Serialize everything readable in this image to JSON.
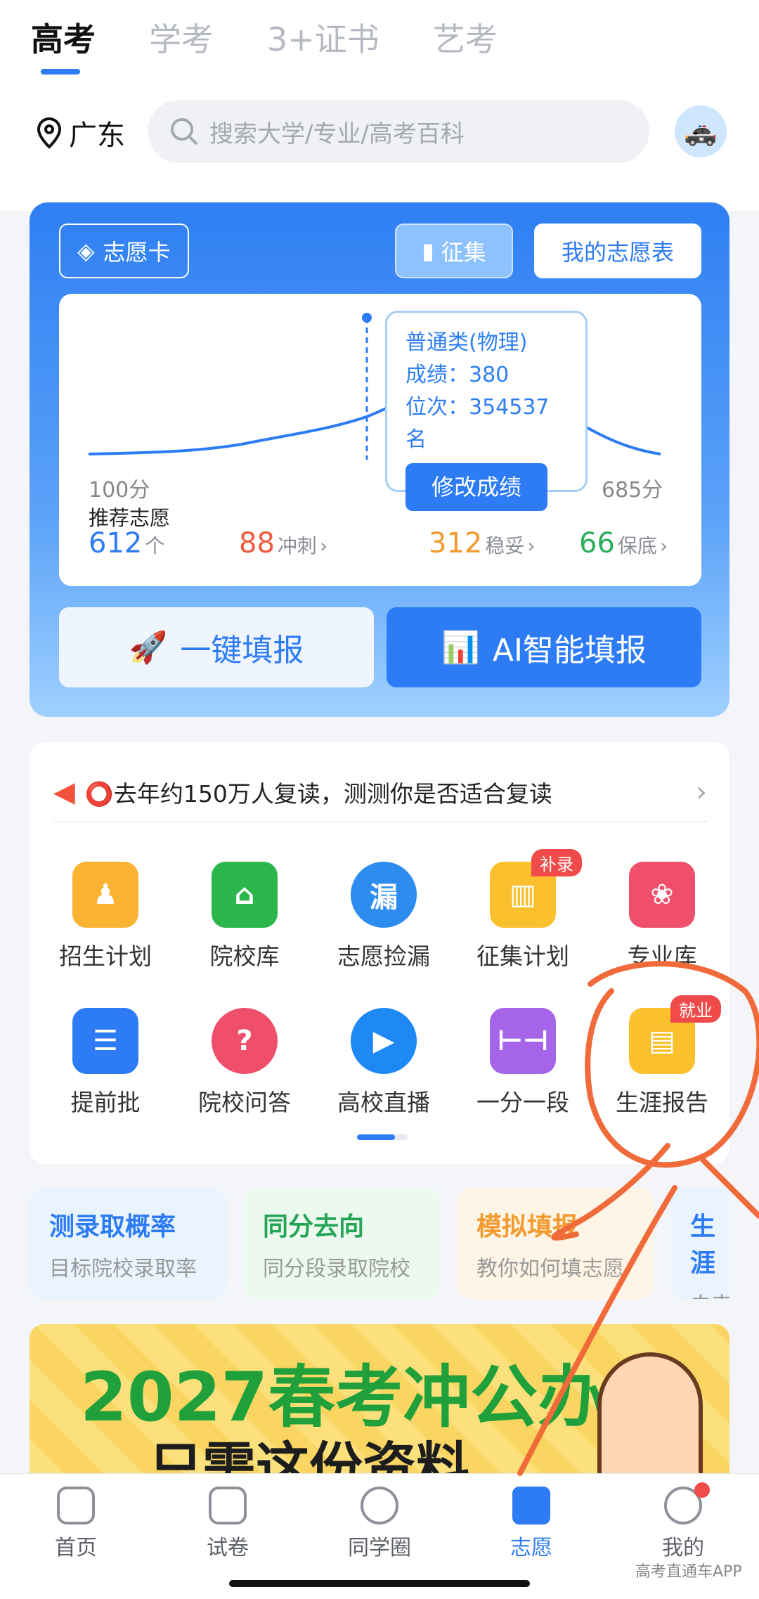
{
  "tabs": [
    "高考",
    "学考",
    "3+证书",
    "艺考"
  ],
  "location": "广东",
  "search": {
    "placeholder": "搜索大学/专业/高考百科"
  },
  "card": {
    "card_label": "志愿卡",
    "zhengji_label": "征集",
    "my_table_label": "我的志愿表",
    "chart": {
      "min_label": "100分",
      "max_label": "685分",
      "tooltip": {
        "category": "普通类(物理)",
        "score": "成绩：380",
        "rank": "位次：354537名",
        "button": "修改成绩"
      },
      "recommend_label": "推荐志愿",
      "recommend_count": "612",
      "recommend_unit": "个",
      "stats": [
        {
          "num": "88",
          "label": "冲刺"
        },
        {
          "num": "312",
          "label": "稳妥"
        },
        {
          "num": "66",
          "label": "保底"
        }
      ]
    },
    "one_click": "一键填报",
    "ai_fill": "AI智能填报"
  },
  "notice": "⭕去年约150万人复读，测测你是否适合复读",
  "grid": [
    {
      "label": "招生计划",
      "icon": "user-icon"
    },
    {
      "label": "院校库",
      "icon": "school-icon"
    },
    {
      "label": "志愿捡漏",
      "icon": "search-icon"
    },
    {
      "label": "征集计划",
      "icon": "chart-icon",
      "badge": "补录"
    },
    {
      "label": "专业库",
      "icon": "book-icon"
    },
    {
      "label": "提前批",
      "icon": "document-icon"
    },
    {
      "label": "院校问答",
      "icon": "question-icon"
    },
    {
      "label": "高校直播",
      "icon": "video-icon"
    },
    {
      "label": "一分一段",
      "icon": "ruler-icon"
    },
    {
      "label": "生涯报告",
      "icon": "report-icon",
      "badge": "就业"
    }
  ],
  "quick": [
    {
      "title": "测录取概率",
      "sub": "目标院校录取率"
    },
    {
      "title": "同分去向",
      "sub": "同分段录取院校"
    },
    {
      "title": "模拟填报",
      "sub": "教你如何填志愿"
    },
    {
      "title": "生涯",
      "sub": "未来"
    }
  ],
  "banner": {
    "line1": "2027春考冲公办",
    "line2": "只需这份资料"
  },
  "nav": [
    "首页",
    "试卷",
    "同学圈",
    "志愿",
    "我的"
  ],
  "watermark": "高考直通车APP"
}
